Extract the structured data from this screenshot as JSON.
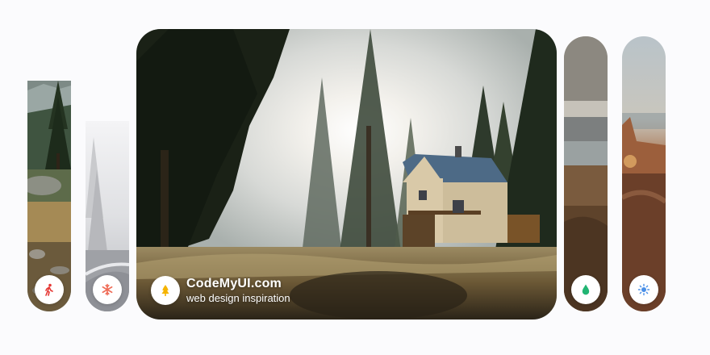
{
  "gallery": {
    "cards": [
      {
        "id": "hiking",
        "icon": "walking-person-icon",
        "icon_color": "#e53935",
        "active": false
      },
      {
        "id": "winter",
        "icon": "snowflake-icon",
        "icon_color": "#ef6c57",
        "active": false
      },
      {
        "id": "forest",
        "icon": "tree-icon",
        "icon_color": "#f5b400",
        "active": true,
        "title": "CodeMyUI.com",
        "subtitle": "web design inspiration"
      },
      {
        "id": "lake",
        "icon": "water-drop-icon",
        "icon_color": "#22b573",
        "active": false
      },
      {
        "id": "desert",
        "icon": "sun-icon",
        "icon_color": "#4a8fe7",
        "active": false
      }
    ]
  }
}
